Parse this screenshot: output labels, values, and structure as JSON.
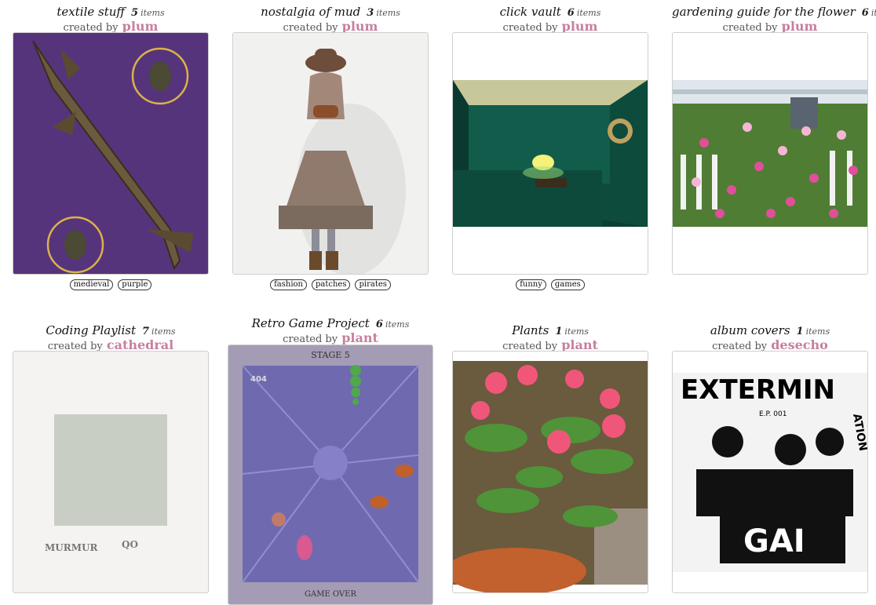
{
  "collections": [
    {
      "title": "textile stuff",
      "count": "5",
      "items_label": "items",
      "created_by": "created by",
      "user": "plum",
      "tags": [
        "medieval",
        "purple"
      ]
    },
    {
      "title": "nostalgia of mud",
      "count": "3",
      "items_label": "items",
      "created_by": "created by",
      "user": "plum",
      "tags": [
        "fashion",
        "patches",
        "pirates"
      ]
    },
    {
      "title": "click vault",
      "count": "6",
      "items_label": "items",
      "created_by": "created by",
      "user": "plum",
      "tags": [
        "funny",
        "games"
      ]
    },
    {
      "title": "gardening guide for the flower",
      "count": "6",
      "items_label": "items",
      "created_by": "created by",
      "user": "plum",
      "tags": []
    },
    {
      "title": "Coding Playlist",
      "count": "7",
      "items_label": "items",
      "created_by": "created by",
      "user": "cathedral",
      "tags": [],
      "cover_text": [
        "MURMUR",
        "QO"
      ]
    },
    {
      "title": "Retro Game Project",
      "count": "6",
      "items_label": "items",
      "created_by": "created by",
      "user": "plant",
      "tags": [],
      "cover_text": [
        "STAGE 5",
        "404",
        "GAME OVER"
      ]
    },
    {
      "title": "Plants",
      "count": "1",
      "items_label": "items",
      "created_by": "created by",
      "user": "plant",
      "tags": []
    },
    {
      "title": "album covers",
      "count": "1",
      "items_label": "items",
      "created_by": "created by",
      "user": "desecho",
      "tags": [],
      "cover_text": [
        "EXTERMIN",
        "ATION",
        "GAI",
        "E.P. 001"
      ]
    }
  ],
  "colors": {
    "username": "#c77fa0",
    "frame_border": "#cfcfcf"
  }
}
